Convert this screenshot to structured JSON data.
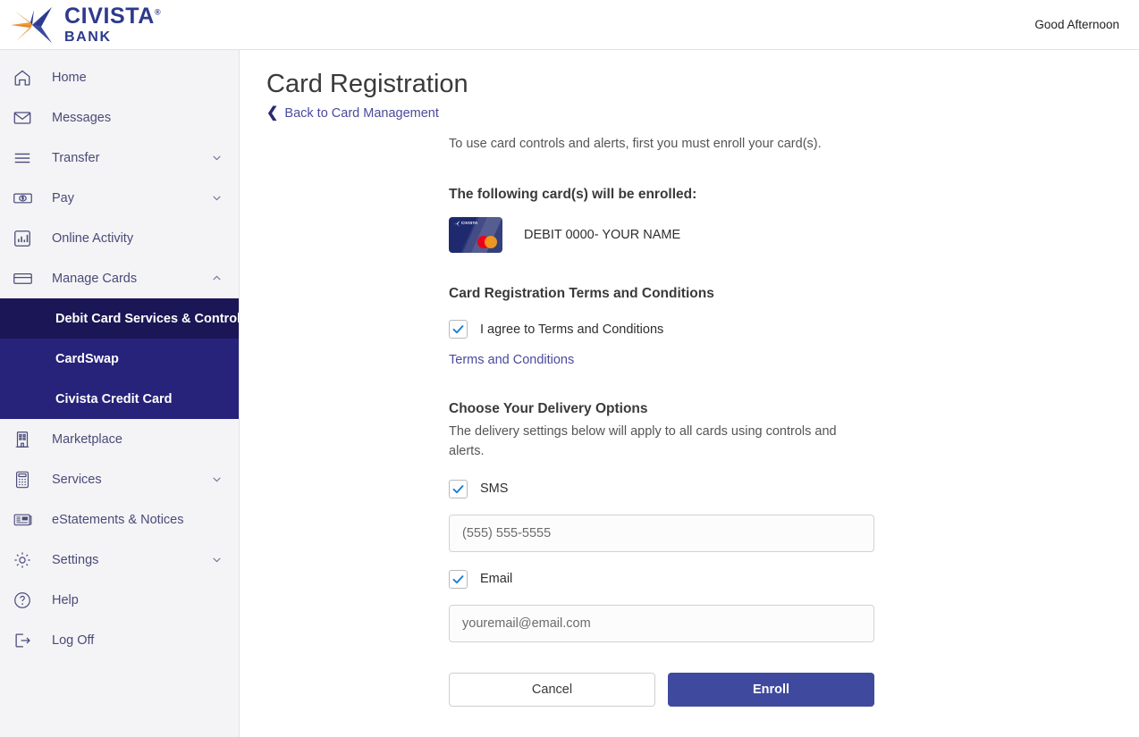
{
  "brand": {
    "name": "CIVISTA",
    "registered_mark": "®",
    "sub": "BANK",
    "logo_icon": "civista-star-logo",
    "colors": {
      "navy": "#2d3a8c",
      "orange": "#f0993a"
    }
  },
  "header": {
    "greeting": "Good Afternoon"
  },
  "sidebar": {
    "items": [
      {
        "label": "Home",
        "icon": "home-icon",
        "expandable": false
      },
      {
        "label": "Messages",
        "icon": "envelope-icon",
        "expandable": false
      },
      {
        "label": "Transfer",
        "icon": "transfer-lines-icon",
        "expandable": true,
        "chevron": "chevron-down-icon"
      },
      {
        "label": "Pay",
        "icon": "banknote-dollar-icon",
        "expandable": true,
        "chevron": "chevron-down-icon"
      },
      {
        "label": "Online Activity",
        "icon": "bar-chart-icon",
        "expandable": false
      },
      {
        "label": "Manage Cards",
        "icon": "credit-card-icon",
        "expandable": true,
        "chevron": "chevron-up-icon",
        "expanded": true
      }
    ],
    "submenu": [
      {
        "label": "Debit Card Services & Controls",
        "active": true
      },
      {
        "label": "CardSwap",
        "active": false
      },
      {
        "label": "Civista Credit Card",
        "active": false
      }
    ],
    "items_after": [
      {
        "label": "Marketplace",
        "icon": "building-icon",
        "expandable": false
      },
      {
        "label": "Services",
        "icon": "calculator-icon",
        "expandable": true,
        "chevron": "chevron-down-icon"
      },
      {
        "label": "eStatements & Notices",
        "icon": "newspaper-icon",
        "expandable": false
      },
      {
        "label": "Settings",
        "icon": "gear-icon",
        "expandable": true,
        "chevron": "chevron-down-icon"
      },
      {
        "label": "Help",
        "icon": "question-circle-icon",
        "expandable": false
      },
      {
        "label": "Log Off",
        "icon": "logout-icon",
        "expandable": false
      }
    ],
    "colors": {
      "background": "#f4f4f6",
      "submenu": "#27227a",
      "active": "#1b1655",
      "text": "#4a4a7a"
    }
  },
  "page": {
    "title": "Card Registration",
    "back_link": "Back to Card Management",
    "back_icon": "chevron-left-icon"
  },
  "form": {
    "intro": "To use card controls and alerts, first you must enroll your card(s).",
    "cards_heading": "The following card(s) will be enrolled:",
    "card": {
      "description": "DEBIT 0000- YOUR NAME",
      "art_icon": "debit-card-art",
      "network_icon": "mastercard-icon",
      "logo_text": "CIVISTA",
      "color": "#1f2a6e"
    },
    "terms_heading": "Card Registration Terms and Conditions",
    "agree_label": "I agree to Terms and Conditions",
    "agree_checked": true,
    "terms_link": "Terms and Conditions",
    "delivery_heading": "Choose Your Delivery Options",
    "delivery_note": "The delivery settings below will apply to all cards using controls and alerts.",
    "sms_label": "SMS",
    "sms_checked": true,
    "sms_value": "",
    "sms_placeholder": "(555) 555-5555",
    "email_label": "Email",
    "email_checked": true,
    "email_value": "",
    "email_placeholder": "youremail@email.com",
    "cancel_label": "Cancel",
    "enroll_label": "Enroll",
    "colors": {
      "primary_button": "#3f4a9e",
      "link": "#4a4a9e",
      "check": "#1a7fd4"
    }
  }
}
